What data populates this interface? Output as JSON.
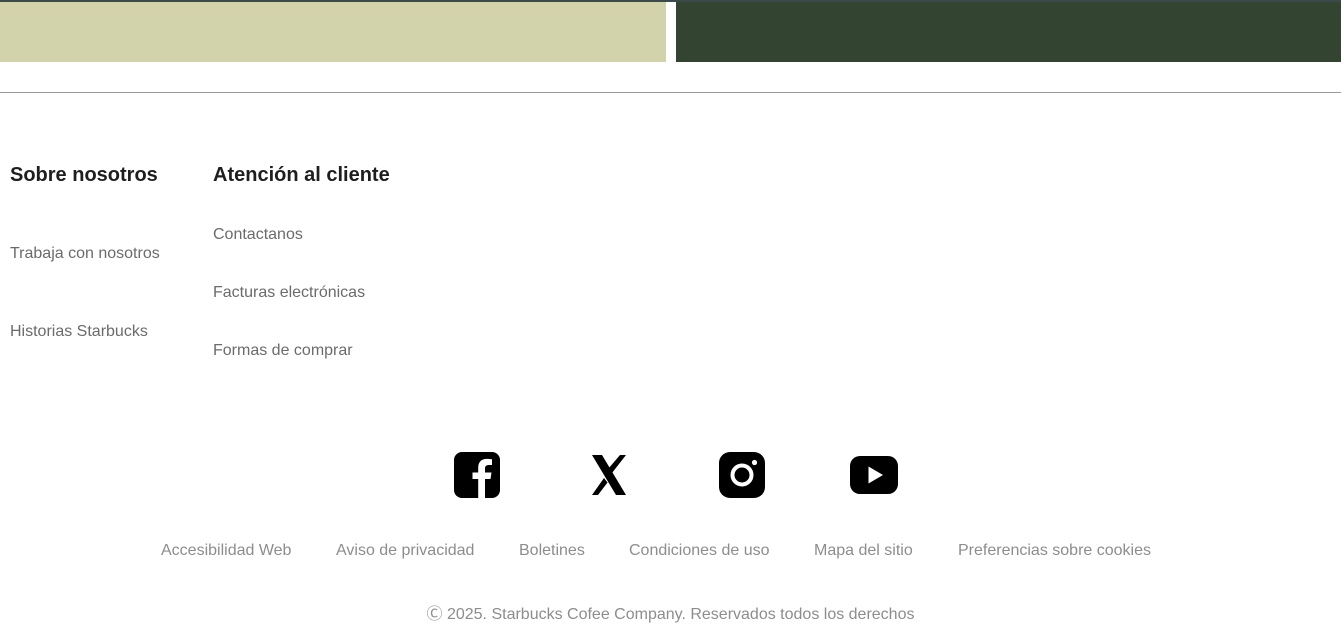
{
  "banners": {
    "left_color": "#d2d3ab",
    "right_color": "#334430"
  },
  "footer": {
    "about": {
      "heading": "Sobre nosotros",
      "links": [
        "Trabaja con nosotros",
        "Historias Starbucks"
      ]
    },
    "customer_service": {
      "heading": "Atención al cliente",
      "links": [
        "Contactanos",
        "Facturas electrónicas",
        "Formas de comprar"
      ]
    },
    "social": [
      {
        "icon": "facebook-icon"
      },
      {
        "icon": "x-icon"
      },
      {
        "icon": "instagram-icon"
      },
      {
        "icon": "youtube-icon"
      }
    ],
    "legal_links": [
      "Accesibilidad Web",
      "Aviso de privacidad",
      "Boletines",
      "Condiciones de uso",
      "Mapa del sitio",
      "Preferencias sobre cookies"
    ],
    "copyright": "Ⓒ 2025. Starbucks Cofee Company. Reservados todos los derechos"
  }
}
